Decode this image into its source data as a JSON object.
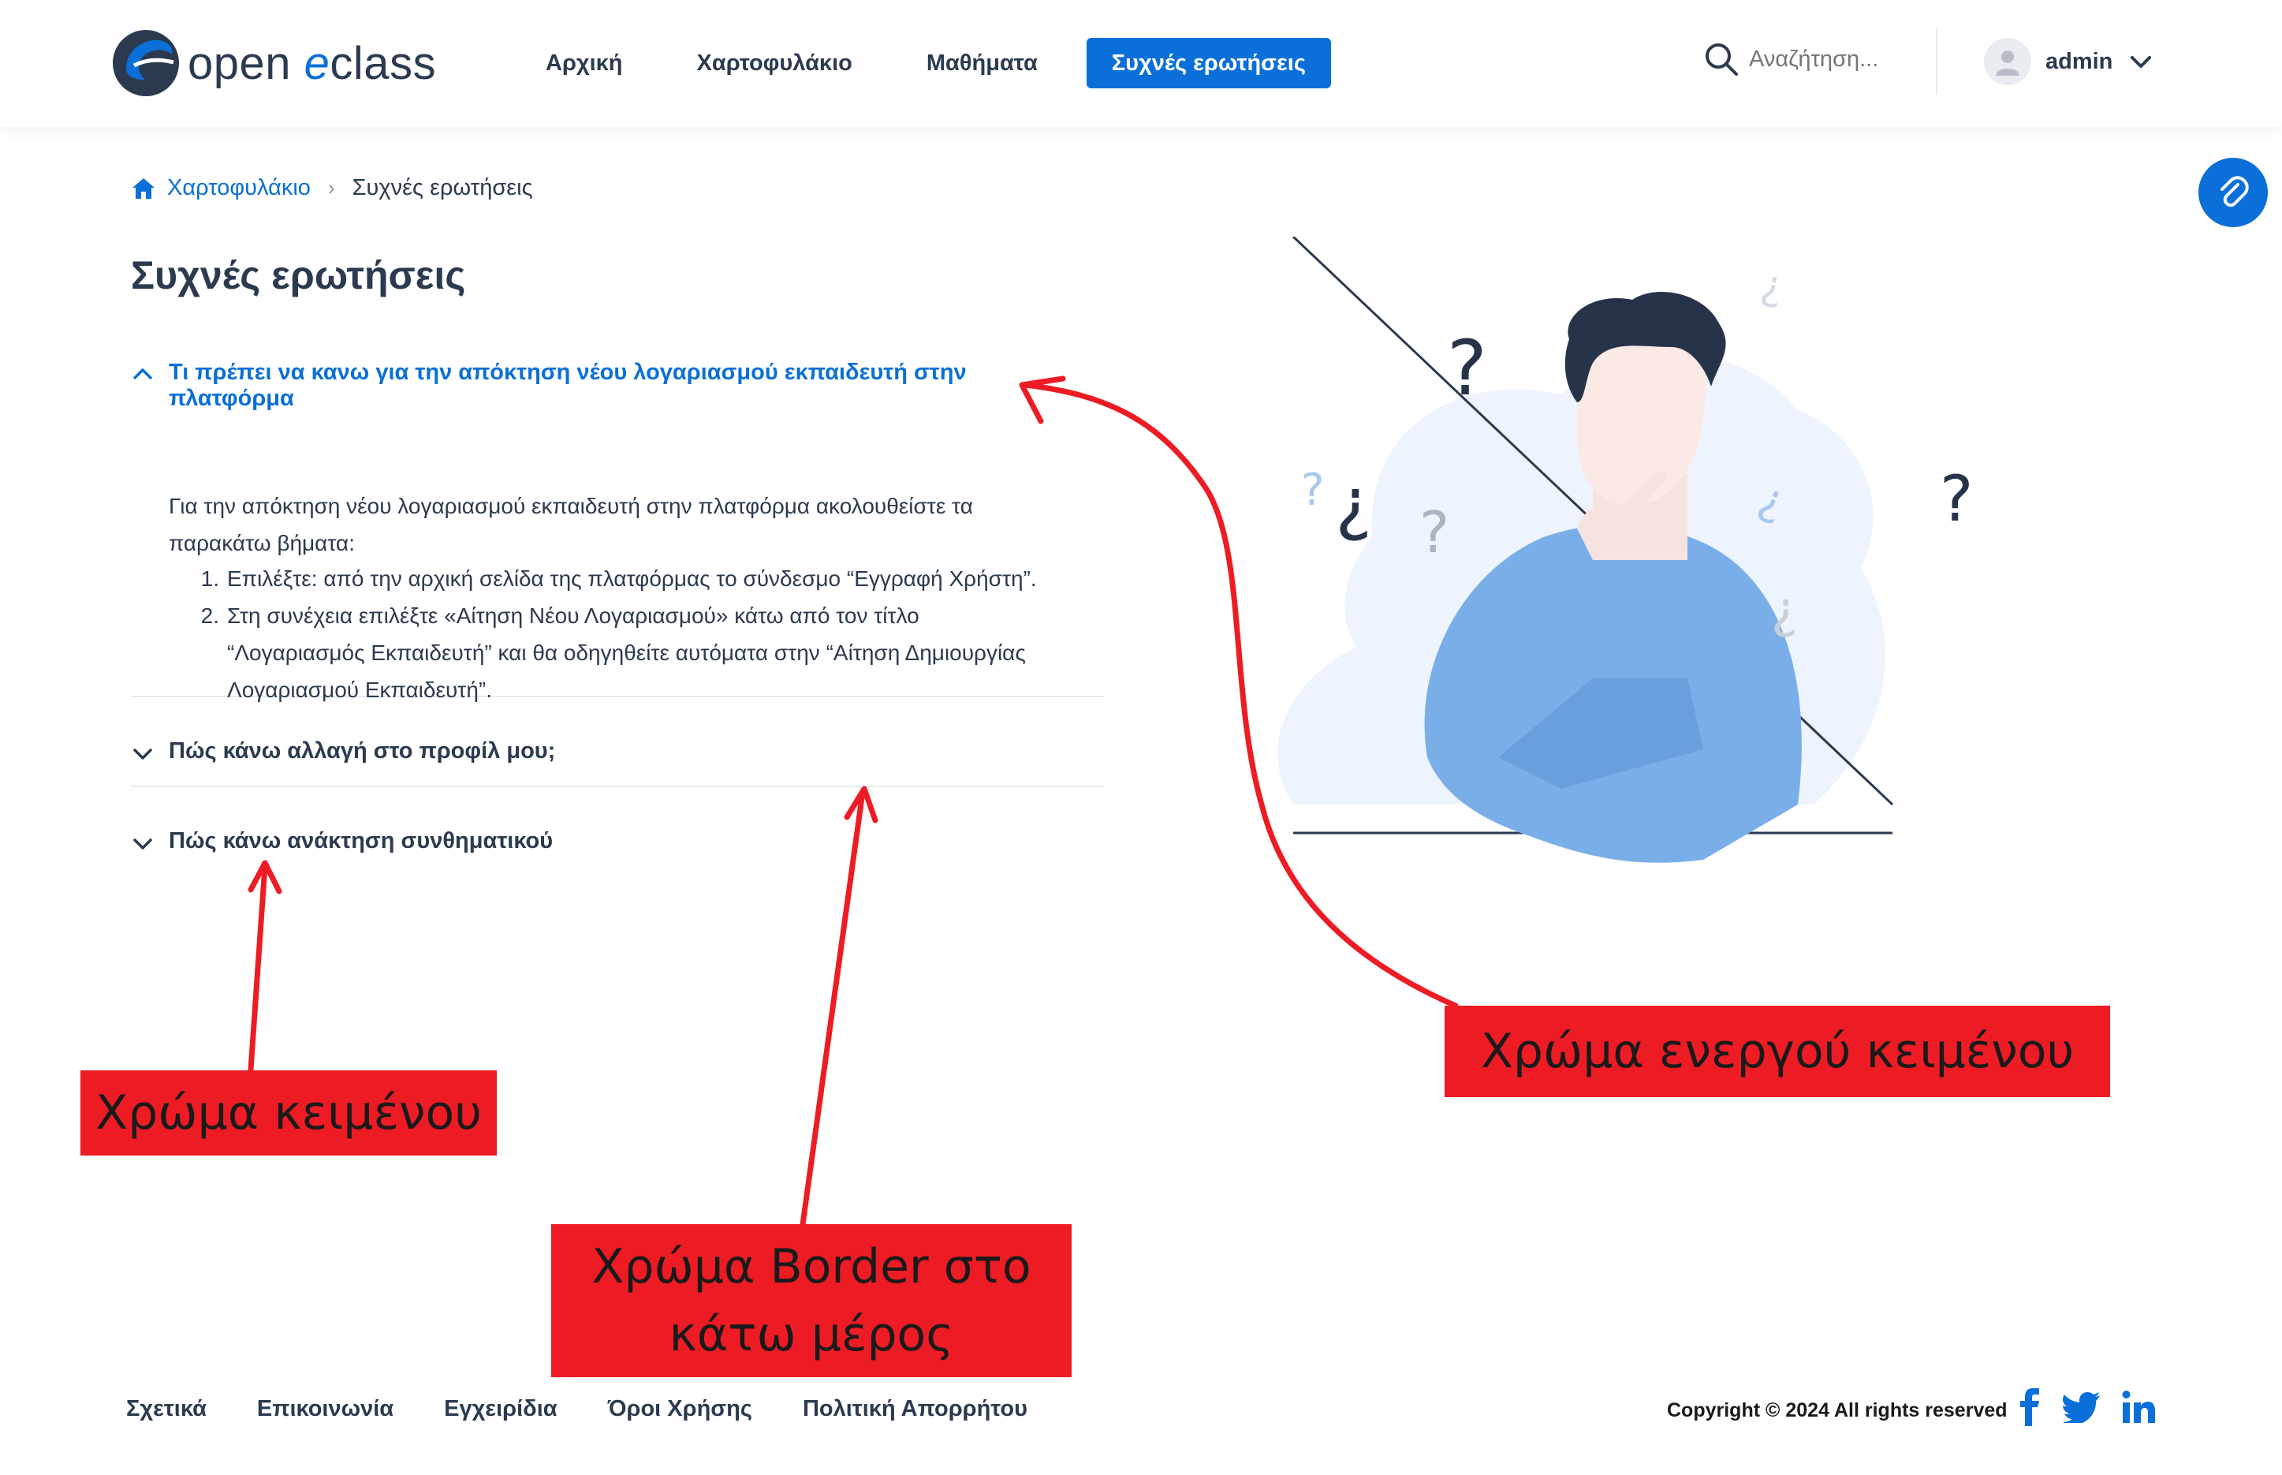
{
  "header": {
    "logo": {
      "part1": "open",
      "part2": "e",
      "part3": "class"
    },
    "nav": [
      "Αρχική",
      "Χαρτοφυλάκιο",
      "Μαθήματα",
      "Συχνές ερωτήσεις"
    ],
    "active_nav_index": 3,
    "search_placeholder": "Αναζήτηση...",
    "user": "admin"
  },
  "breadcrumb": {
    "home": "Χαρτοφυλάκιο",
    "current": "Συχνές ερωτήσεις"
  },
  "page_title": "Συχνές ερωτήσεις",
  "faq": [
    {
      "question": "Τι πρέπει να κανω για την απόκτηση νέου λογαριασμού εκπαιδευτή στην πλατφόρμα",
      "open": true,
      "answer_intro": "Για την απόκτηση νέου λογαριασμού εκπαιδευτή στην πλατφόρμα ακολουθείστε τα παρακάτω βήματα:",
      "steps": [
        "Επιλέξτε: από την αρχική σελίδα της πλατφόρμας το σύνδεσμο “Εγγραφή Χρήστη”.",
        "Στη συνέχεια επιλέξτε «Αίτηση Νέου Λογαριασμού» κάτω από τον τίτλο “Λογαριασμός Εκπαιδευτή” και θα οδηγηθείτε αυτόματα στην “Αίτηση Δημιουργίας Λογαριασμού Εκπαιδευτή”."
      ]
    },
    {
      "question": "Πώς κάνω αλλαγή στο προφίλ μου;",
      "open": false
    },
    {
      "question": "Πώς κάνω ανάκτηση συνθηματικού",
      "open": false
    }
  ],
  "annotations": {
    "text_color": "Χρώμα κειμένου",
    "border_color": "Χρώμα Border στο κάτω μέρος",
    "active_text_color": "Χρώμα ενεργού κειμένου"
  },
  "footer": {
    "links": [
      "Σχετικά",
      "Επικοινωνία",
      "Εγχειρίδια",
      "Όροι Χρήσης",
      "Πολιτική Απορρήτου"
    ],
    "copyright": "Copyright © 2024 All rights reserved",
    "social": [
      "facebook-icon",
      "twitter-icon",
      "linkedin-icon"
    ]
  },
  "colors": {
    "accent": "#0a6fd8",
    "text": "#2b3a4f",
    "border": "#e6eaf0",
    "annotation": "#ed1c24"
  }
}
